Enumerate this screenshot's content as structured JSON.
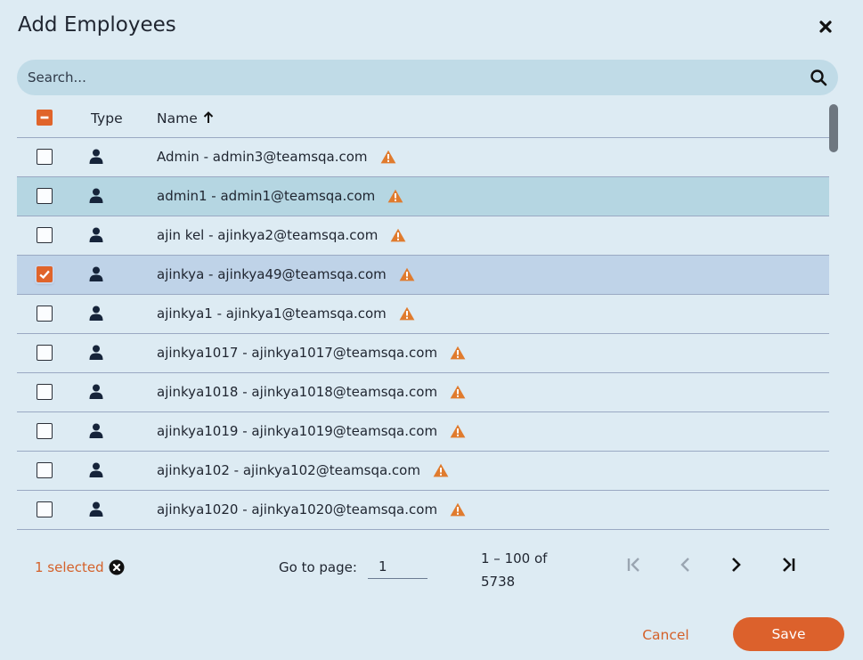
{
  "dialog": {
    "title": "Add Employees"
  },
  "search": {
    "placeholder": "Search..."
  },
  "table": {
    "columns": {
      "type": "Type",
      "name": "Name"
    },
    "rows": [
      {
        "label": "Admin - admin3@teamsqa.com",
        "checked": false
      },
      {
        "label": "admin1 - admin1@teamsqa.com",
        "checked": false
      },
      {
        "label": "ajin kel - ajinkya2@teamsqa.com",
        "checked": false
      },
      {
        "label": "ajinkya - ajinkya49@teamsqa.com",
        "checked": true
      },
      {
        "label": "ajinkya1 - ajinkya1@teamsqa.com",
        "checked": false
      },
      {
        "label": "ajinkya1017 - ajinkya1017@teamsqa.com",
        "checked": false
      },
      {
        "label": "ajinkya1018 - ajinkya1018@teamsqa.com",
        "checked": false
      },
      {
        "label": "ajinkya1019 - ajinkya1019@teamsqa.com",
        "checked": false
      },
      {
        "label": "ajinkya102 - ajinkya102@teamsqa.com",
        "checked": false
      },
      {
        "label": "ajinkya1020 - ajinkya1020@teamsqa.com",
        "checked": false
      }
    ]
  },
  "footer": {
    "selected_text": "1 selected",
    "goto_label": "Go to page:",
    "goto_value": "1",
    "range_text": "1 – 100 of 5738",
    "cancel_label": "Cancel",
    "save_label": "Save"
  },
  "colors": {
    "accent": "#dc612c",
    "warning": "#e07b2e",
    "background": "#ddebf3"
  }
}
